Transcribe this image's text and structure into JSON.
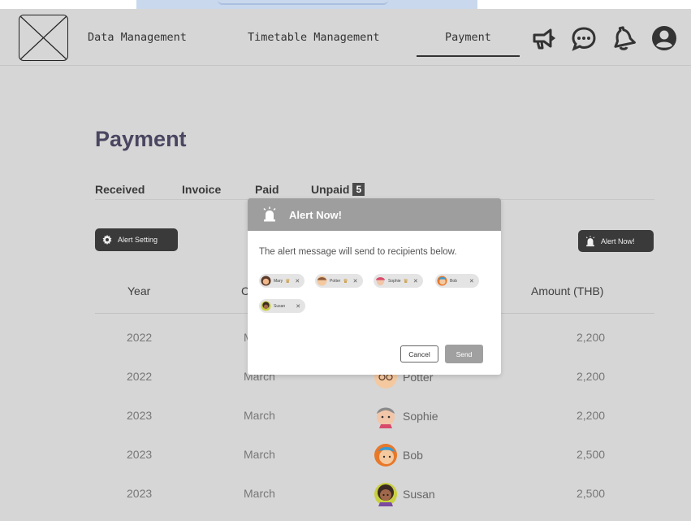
{
  "nav": {
    "items": [
      {
        "label": "Data Management"
      },
      {
        "label": "Timetable Management"
      },
      {
        "label": "Payment",
        "active": true
      }
    ],
    "icons": [
      "megaphone-icon",
      "chat-icon",
      "bell-icon",
      "user-icon"
    ]
  },
  "page": {
    "title": "Payment",
    "tabs": [
      {
        "label": "Received"
      },
      {
        "label": "Invoice"
      },
      {
        "label": "Paid"
      },
      {
        "label": "Unpaid",
        "badge": "5"
      }
    ],
    "alert_setting_label": "Alert Setting",
    "alert_now_label": "Alert Now!"
  },
  "table": {
    "headers": {
      "year": "Year",
      "month": "C",
      "amount": "Amount (THB)"
    },
    "rows": [
      {
        "year": "2022",
        "month": "M",
        "name": "",
        "amount": "2,200"
      },
      {
        "year": "2022",
        "month": "March",
        "name": "Potter",
        "amount": "2,200"
      },
      {
        "year": "2023",
        "month": "March",
        "name": "Sophie",
        "amount": "2,200"
      },
      {
        "year": "2023",
        "month": "March",
        "name": "Bob",
        "amount": "2,500"
      },
      {
        "year": "2023",
        "month": "March",
        "name": "Susan",
        "amount": "2,500"
      }
    ]
  },
  "modal": {
    "title": "Alert Now!",
    "message": "The alert message will send to recipients below.",
    "recipients": [
      "Mary",
      "Potter",
      "Sophie",
      "Bob",
      "Susan"
    ],
    "cancel_label": "Cancel",
    "send_label": "Send"
  },
  "colors": {
    "background": "#d6d6d6",
    "dark_button": "#3a3a3a",
    "modal_header": "#9e9e9e",
    "title": "#4a4560"
  }
}
